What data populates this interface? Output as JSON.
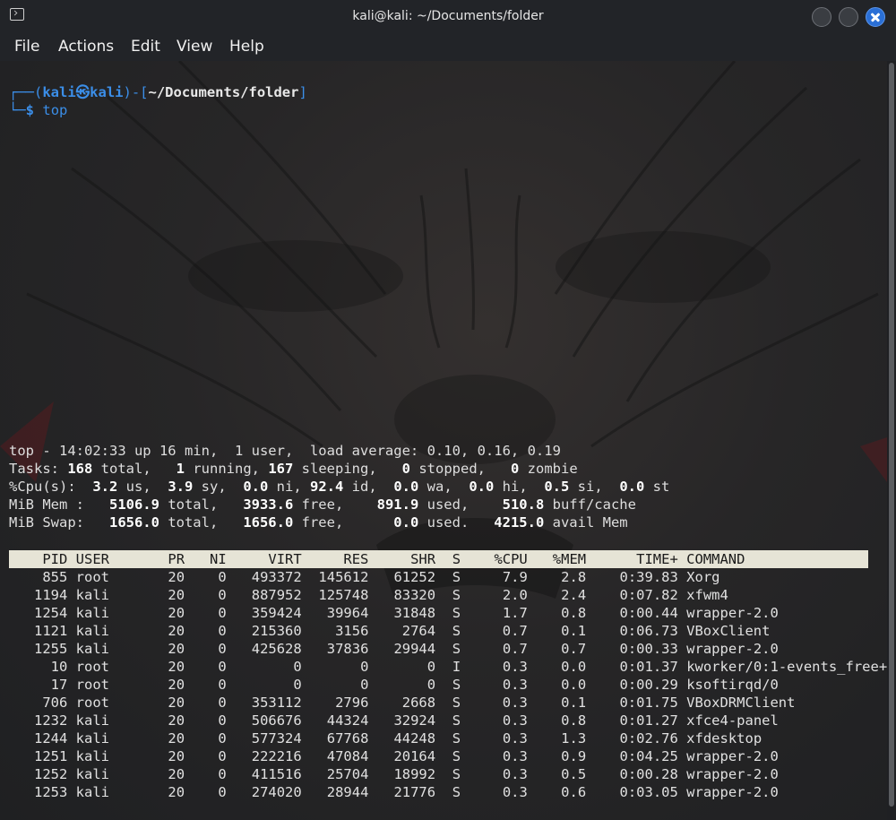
{
  "window": {
    "title": "kali@kali: ~/Documents/folder",
    "menu": [
      "File",
      "Actions",
      "Edit",
      "View",
      "Help"
    ]
  },
  "prompt": {
    "user": "kali",
    "host": "kali",
    "path": "~/Documents/folder",
    "command": "top"
  },
  "summary": {
    "uptime_line": "top - 14:02:33 up 16 min,  1 user,  load average: 0.10, 0.16, 0.19",
    "tasks": {
      "total": "168",
      "running": "1",
      "sleeping": "167",
      "stopped": "0",
      "zombie": "0"
    },
    "cpu": {
      "us": "3.2",
      "sy": "3.9",
      "ni": "0.0",
      "id": "92.4",
      "wa": "0.0",
      "hi": "0.0",
      "si": "0.5",
      "st": "0.0"
    },
    "mem": {
      "total": "5106.9",
      "free": "3933.6",
      "used": "891.9",
      "buff_cache": "510.8"
    },
    "swap": {
      "total": "1656.0",
      "free": "1656.0",
      "used": "0.0",
      "avail": "4215.0"
    }
  },
  "table": {
    "headers": [
      "PID",
      "USER",
      "PR",
      "NI",
      "VIRT",
      "RES",
      "SHR",
      "S",
      "%CPU",
      "%MEM",
      "TIME+",
      "COMMAND"
    ],
    "rows": [
      [
        "855",
        "root",
        "20",
        "0",
        "493372",
        "145612",
        "61252",
        "S",
        "7.9",
        "2.8",
        "0:39.83",
        "Xorg"
      ],
      [
        "1194",
        "kali",
        "20",
        "0",
        "887952",
        "125748",
        "83320",
        "S",
        "2.0",
        "2.4",
        "0:07.82",
        "xfwm4"
      ],
      [
        "1254",
        "kali",
        "20",
        "0",
        "359424",
        "39964",
        "31848",
        "S",
        "1.7",
        "0.8",
        "0:00.44",
        "wrapper-2.0"
      ],
      [
        "1121",
        "kali",
        "20",
        "0",
        "215360",
        "3156",
        "2764",
        "S",
        "0.7",
        "0.1",
        "0:06.73",
        "VBoxClient"
      ],
      [
        "1255",
        "kali",
        "20",
        "0",
        "425628",
        "37836",
        "29944",
        "S",
        "0.7",
        "0.7",
        "0:00.33",
        "wrapper-2.0"
      ],
      [
        "10",
        "root",
        "20",
        "0",
        "0",
        "0",
        "0",
        "I",
        "0.3",
        "0.0",
        "0:01.37",
        "kworker/0:1-events_free+"
      ],
      [
        "17",
        "root",
        "20",
        "0",
        "0",
        "0",
        "0",
        "S",
        "0.3",
        "0.0",
        "0:00.29",
        "ksoftirqd/0"
      ],
      [
        "706",
        "root",
        "20",
        "0",
        "353112",
        "2796",
        "2668",
        "S",
        "0.3",
        "0.1",
        "0:01.75",
        "VBoxDRMClient"
      ],
      [
        "1232",
        "kali",
        "20",
        "0",
        "506676",
        "44324",
        "32924",
        "S",
        "0.3",
        "0.8",
        "0:01.27",
        "xfce4-panel"
      ],
      [
        "1244",
        "kali",
        "20",
        "0",
        "577324",
        "67768",
        "44248",
        "S",
        "0.3",
        "1.3",
        "0:02.76",
        "xfdesktop"
      ],
      [
        "1251",
        "kali",
        "20",
        "0",
        "222216",
        "47084",
        "20164",
        "S",
        "0.3",
        "0.9",
        "0:04.25",
        "wrapper-2.0"
      ],
      [
        "1252",
        "kali",
        "20",
        "0",
        "411516",
        "25704",
        "18992",
        "S",
        "0.3",
        "0.5",
        "0:00.28",
        "wrapper-2.0"
      ],
      [
        "1253",
        "kali",
        "20",
        "0",
        "274020",
        "28944",
        "21776",
        "S",
        "0.3",
        "0.6",
        "0:03.05",
        "wrapper-2.0"
      ]
    ]
  }
}
